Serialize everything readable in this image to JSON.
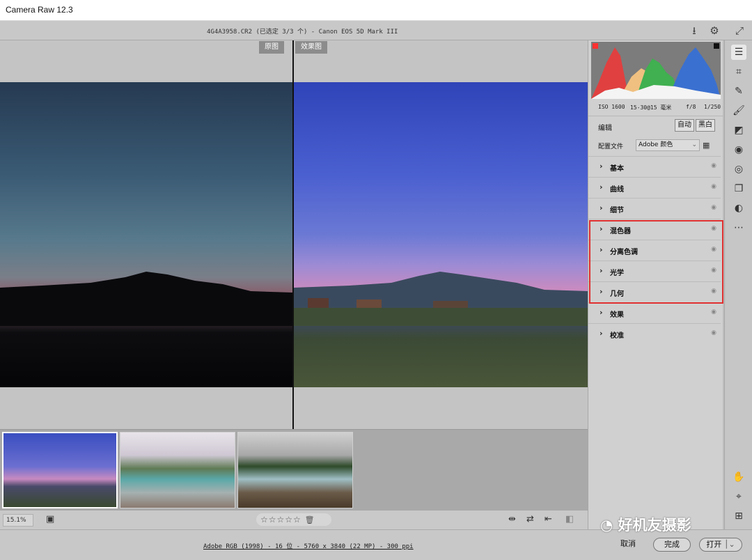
{
  "app": {
    "title": "Camera Raw 12.3"
  },
  "header": {
    "filename": "4G4A3958.CR2 (已选定 3/3 个) - Canon EOS 5D Mark III"
  },
  "preview": {
    "before_label": "原图",
    "after_label": "效果图"
  },
  "status": {
    "zoom": "15.1%",
    "stars": "☆☆☆☆☆"
  },
  "workflow": "Adobe RGB (1998) - 16 位 - 5760 x 3840 (22 MP) - 300 ppi",
  "exif": {
    "iso": "ISO 1600",
    "lens": "15-30@15 毫米",
    "aperture": "f/8",
    "shutter": "1/250"
  },
  "edit": {
    "label": "编辑",
    "auto": "自动",
    "bw": "黑白"
  },
  "profile": {
    "label": "配置文件",
    "value": "Adobe 颜色"
  },
  "sections": [
    "基本",
    "曲线",
    "细节",
    "混色器",
    "分离色调",
    "光学",
    "几何",
    "效果",
    "校准"
  ],
  "buttons": {
    "cancel": "取消",
    "done": "完成",
    "open": "打开"
  },
  "watermark": "好机友摄影",
  "colors": {
    "highlight_box": "#e03030"
  }
}
